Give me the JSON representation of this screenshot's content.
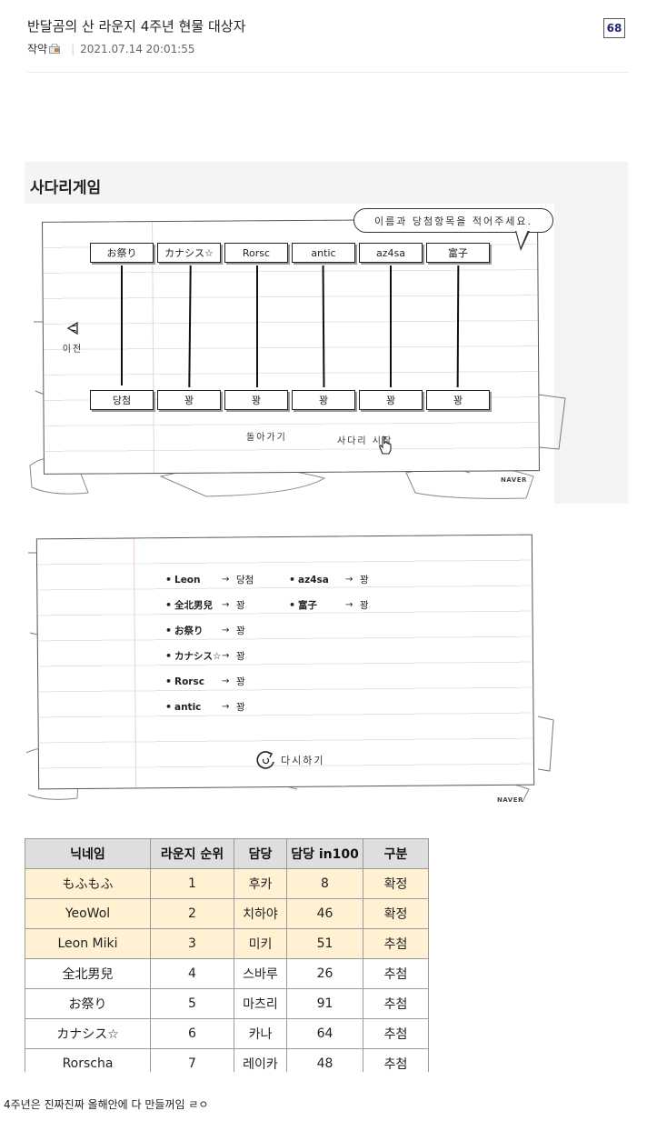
{
  "post": {
    "title": "반달곰의 산 라운지 4주년 현물 대상자",
    "author": "작약",
    "date": "2021.07.14 20:01:55",
    "comment_count": "68"
  },
  "ladder": {
    "heading": "사다리게임",
    "speech": "이름과 당첨항목을 적어주세요.",
    "names": [
      "お祭り",
      "カナシス☆",
      "Rorsc",
      "antic",
      "az4sa",
      "富子"
    ],
    "prizes": [
      "당첨",
      "꽝",
      "꽝",
      "꽝",
      "꽝",
      "꽝"
    ],
    "prev_label": "이전",
    "back_label": "돌아가기",
    "start_label": "사다리 시작",
    "naver_mark": "NAVER"
  },
  "results": {
    "rows": [
      {
        "name": "Leon",
        "arrow": "→",
        "result": "당첨"
      },
      {
        "name": "全北男兒",
        "arrow": "→",
        "result": "꽝"
      },
      {
        "name": "お祭り",
        "arrow": "→",
        "result": "꽝"
      },
      {
        "name": "カナシス☆",
        "arrow": "→",
        "result": "꽝"
      },
      {
        "name": "Rorsc",
        "arrow": "→",
        "result": "꽝"
      },
      {
        "name": "antic",
        "arrow": "→",
        "result": "꽝"
      },
      {
        "name": "az4sa",
        "arrow": "→",
        "result": "꽝"
      },
      {
        "name": "富子",
        "arrow": "→",
        "result": "꽝"
      }
    ],
    "retry_label": "다시하기",
    "naver_mark": "NAVER"
  },
  "table": {
    "headers": [
      "닉네임",
      "라운지 순위",
      "담당",
      "담당 in100",
      "구분"
    ],
    "rows": [
      [
        "もふもふ",
        "1",
        "후카",
        "8",
        "확정"
      ],
      [
        "YeoWol",
        "2",
        "치하야",
        "46",
        "확정"
      ],
      [
        "Leon Miki",
        "3",
        "미키",
        "51",
        "추첨"
      ],
      [
        "全北男兒",
        "4",
        "스바루",
        "26",
        "추첨"
      ],
      [
        "お祭り",
        "5",
        "마츠리",
        "91",
        "추첨"
      ],
      [
        "カナシス☆",
        "6",
        "카나",
        "64",
        "추첨"
      ],
      [
        "Rorscha",
        "7",
        "레이카",
        "48",
        "추첨"
      ]
    ],
    "highlight_color": "#fff1d2",
    "header_color": "#dedede"
  },
  "footer": "4주년은 진짜진짜 올해안에 다 만들꺼임 ㄹㅇ"
}
